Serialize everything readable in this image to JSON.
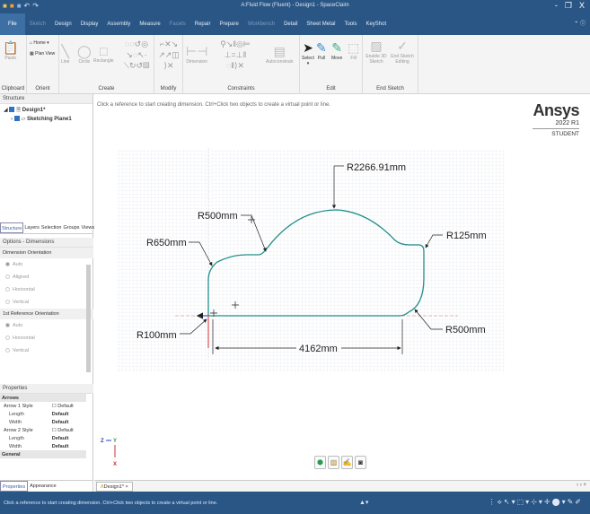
{
  "window": {
    "title": "A:Fluid Flow (Fluent) - Design1 - SpaceClaim",
    "controls": [
      "-",
      "❐",
      "X"
    ]
  },
  "tabs": [
    {
      "label": "File",
      "state": "file"
    },
    {
      "label": "Sketch",
      "state": "dim"
    },
    {
      "label": "Design"
    },
    {
      "label": "Display"
    },
    {
      "label": "Assembly"
    },
    {
      "label": "Measure"
    },
    {
      "label": "Facets",
      "state": "dim"
    },
    {
      "label": "Repair"
    },
    {
      "label": "Prepare"
    },
    {
      "label": "Workbench",
      "state": "dim"
    },
    {
      "label": "Detail"
    },
    {
      "label": "Sheet Metal"
    },
    {
      "label": "Tools"
    },
    {
      "label": "KeyShot"
    }
  ],
  "ribbon": {
    "clipboard": {
      "label": "Clipboard",
      "paste": "Paste"
    },
    "orient": {
      "label": "Orient",
      "home": "Home",
      "plan_view": "Plan View"
    },
    "create": {
      "label": "Create",
      "line": "Line",
      "circle": "Circle",
      "rectangle": "Rectangle"
    },
    "modify": {
      "label": "Modify"
    },
    "constraints": {
      "label": "Constraints",
      "dimension": "Dimension",
      "autoconstrain": "Autoconstrain"
    },
    "edit": {
      "label": "Edit",
      "select": "Select",
      "pull": "Pull",
      "move": "Move",
      "fill": "Fill"
    },
    "end_sketch": {
      "label": "End Sketch",
      "enable_3d": "Enable 3D Sketch",
      "end_editing": "End Sketch Editing"
    }
  },
  "structure": {
    "title": "Structure",
    "items": [
      {
        "label": "Design1*"
      },
      {
        "label": "Sketching Plane1"
      }
    ]
  },
  "panel_tabs": [
    {
      "label": "Structure",
      "active": true
    },
    {
      "label": "Layers"
    },
    {
      "label": "Selection"
    },
    {
      "label": "Groups"
    },
    {
      "label": "Views"
    }
  ],
  "options": {
    "title": "Options - Dimensions",
    "dim_orientation": {
      "title": "Dimension Orientation",
      "choices": [
        "Auto",
        "Aligned",
        "Horizontal",
        "Vertical"
      ],
      "selected": "Auto"
    },
    "ref_orientation": {
      "title": "1st Reference Orientation",
      "choices": [
        "Auto",
        "Horizontal",
        "Vertical"
      ],
      "selected": "Auto"
    }
  },
  "properties": {
    "title": "Properties",
    "arrows": "Arrows",
    "arrow1": "Arrow 1 Style",
    "arrow2": "Arrow 2 Style",
    "default": "Default",
    "length": "Length",
    "width": "Width",
    "default_bold": "Default",
    "general": "General"
  },
  "bottom_tabs": [
    "Properties",
    "Appearance"
  ],
  "viewport": {
    "hint": "Click a reference to start creating dimension. Ctrl+Click two objects to create a virtual point or line.",
    "logo": {
      "brand": "Ansys",
      "version": "2022 R1",
      "edition": "STUDENT"
    },
    "dimensions": {
      "top": "R2266.91mm",
      "r500a": "R500mm",
      "r650": "R650mm",
      "r125": "R125mm",
      "r100": "R100mm",
      "r500b": "R500mm",
      "length": "4162mm"
    },
    "triad": {
      "z": "Z",
      "y": "Y",
      "x": "X"
    },
    "colors": {
      "profile": "#1f8f8a",
      "grid": "#d5d8e6",
      "axis_red": "#e05050",
      "axis_blue": "#3050e0"
    }
  },
  "doc_tab": {
    "label": "Design1*"
  },
  "status": {
    "message": "Click a reference to start creating dimension. Ctrl+Click two objects to create a virtual point or line."
  }
}
